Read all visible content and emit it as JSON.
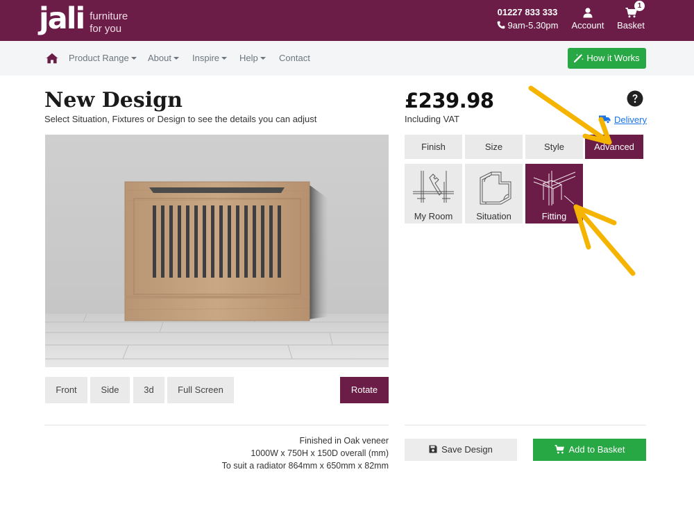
{
  "header": {
    "logo_mark": "jali",
    "logo_tagline_1": "furniture",
    "logo_tagline_2": "for you",
    "phone": "01227 833 333",
    "hours": "9am-5.30pm",
    "account_label": "Account",
    "basket_label": "Basket",
    "basket_count": "1",
    "brand_color": "#6b1d47"
  },
  "nav": {
    "home_icon": "home-icon",
    "items": [
      {
        "label": "Product Range",
        "dropdown": true
      },
      {
        "label": "About",
        "dropdown": true
      },
      {
        "label": "Inspire",
        "dropdown": true
      },
      {
        "label": "Help",
        "dropdown": true
      },
      {
        "label": "Contact",
        "dropdown": false
      }
    ],
    "how_it_works": "How it Works"
  },
  "design": {
    "title": "New Design",
    "subtitle": "Select Situation, Fixtures or Design to see the details you can adjust",
    "view_buttons": [
      "Front",
      "Side",
      "3d",
      "Full Screen"
    ],
    "rotate_label": "Rotate",
    "spec": [
      "Finished in Oak veneer",
      "1000W x 750H x 150D overall (mm)",
      "To suit a radiator 864mm x 650mm x 82mm"
    ]
  },
  "pricing": {
    "price": "£239.98",
    "vat_note": "Including VAT",
    "delivery_label": "Delivery"
  },
  "options": {
    "tabs": [
      {
        "label": "Finish",
        "active": false
      },
      {
        "label": "Size",
        "active": false
      },
      {
        "label": "Style",
        "active": false
      },
      {
        "label": "Advanced",
        "active": true
      }
    ],
    "tiles": [
      {
        "label": "My Room",
        "icon": "room-wrench-icon",
        "active": false
      },
      {
        "label": "Situation",
        "icon": "floorplan-icon",
        "active": false
      },
      {
        "label": "Fitting",
        "icon": "corner-fitting-icon",
        "active": true
      }
    ]
  },
  "actions": {
    "save_label": "Save Design",
    "add_label": "Add to Basket"
  },
  "colors": {
    "brand": "#6b1d47",
    "success": "#28a745",
    "link": "#1a73e8",
    "annotation": "#f5b400"
  }
}
